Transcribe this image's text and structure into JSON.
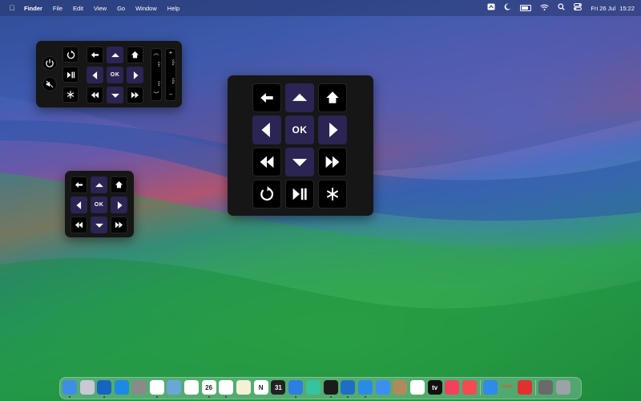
{
  "menubar": {
    "apple_icon": "apple-logo-icon",
    "app_name": "Finder",
    "menus": [
      "File",
      "Edit",
      "View",
      "Go",
      "Window",
      "Help"
    ],
    "status_icons": [
      "screen-share-icon",
      "focus-moon-icon",
      "battery-icon",
      "wifi-icon",
      "search-icon",
      "control-center-icon"
    ],
    "battery_level": 0.8,
    "clock": {
      "date": "Fri 26 Jul",
      "time": "15:22"
    }
  },
  "remote": {
    "ok_label": "OK",
    "accent_color": "#2a2552",
    "button_color": "#000000",
    "panel_color": "#161616",
    "small_remote_buttons": [
      "power-icon",
      "replay-icon",
      "mute-icon",
      "play-pause-icon",
      "asterisk-icon",
      "back-arrow-icon",
      "up-chevron-icon",
      "home-icon",
      "left-chevron-icon",
      "ok",
      "right-chevron-icon",
      "rewind-icon",
      "down-chevron-icon",
      "fast-forward-icon",
      "channel-rocker",
      "volume-rocker"
    ],
    "channel_label": "CH",
    "volume_label": "VOL",
    "plus_label": "+",
    "minus_label": "−"
  },
  "dock": {
    "apps": [
      {
        "name": "Finder",
        "color": "#3f8ee6"
      },
      {
        "name": "Launchpad",
        "color": "#c9c9d6"
      },
      {
        "name": "Outlook",
        "color": "#1565c0"
      },
      {
        "name": "App Store",
        "color": "#1e88e5"
      },
      {
        "name": "System Settings",
        "color": "#8a8a8a"
      },
      {
        "name": "Slack",
        "color": "#ffffff"
      },
      {
        "name": "Preview",
        "color": "#6aa7d8"
      },
      {
        "name": "Photos",
        "color": "#ffffff"
      },
      {
        "name": "Calendar",
        "color": "#ffffff",
        "label": "26"
      },
      {
        "name": "Reminders",
        "color": "#ffffff"
      },
      {
        "name": "Notes",
        "color": "#f5f0d8"
      },
      {
        "name": "Notion",
        "color": "#ffffff",
        "label": "N"
      },
      {
        "name": "Notion Calendar",
        "color": "#222222",
        "label": "31"
      },
      {
        "name": "Maps",
        "color": "#2e7de0"
      },
      {
        "name": "Sequence",
        "color": "#36c3a0"
      },
      {
        "name": "Terminal",
        "color": "#1b1b1b"
      },
      {
        "name": "VS Code",
        "color": "#1e6fc3"
      },
      {
        "name": "Safari",
        "color": "#2a8be6"
      },
      {
        "name": "Mail",
        "color": "#3c8ff0"
      },
      {
        "name": "Keka",
        "color": "#b08a5a"
      },
      {
        "name": "Freeform",
        "color": "#ffffff"
      },
      {
        "name": "Apple TV",
        "color": "#111111",
        "label": "tv"
      },
      {
        "name": "Music",
        "color": "#f3405f"
      },
      {
        "name": "News",
        "color": "#f24b52"
      },
      {
        "name": "Pages",
        "color": "#2f8bea"
      },
      {
        "name": "HTTP Toolkit",
        "color": "#e3532f",
        "label": "HTTP"
      },
      {
        "name": "Remote",
        "color": "#e03030"
      },
      {
        "name": "Downloads",
        "color": "#6a6a6a"
      },
      {
        "name": "Trash",
        "color": "#9aa3a8"
      }
    ]
  }
}
